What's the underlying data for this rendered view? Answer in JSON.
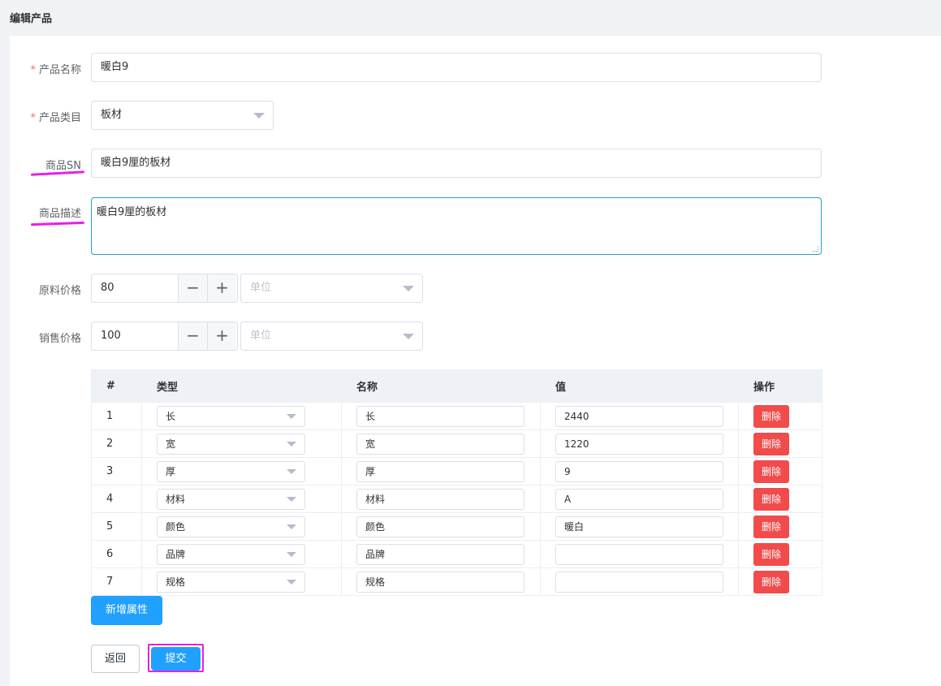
{
  "page": {
    "title": "编辑产品"
  },
  "form": {
    "name": {
      "label": "产品名称",
      "required_mark": "*",
      "value": "暖白9"
    },
    "category": {
      "label": "产品类目",
      "required_mark": "*",
      "value": "板材"
    },
    "sn": {
      "label": "商品SN",
      "value": "暖白9厘的板材"
    },
    "description": {
      "label": "商品描述",
      "value": "暖白9厘的板材"
    },
    "raw_price": {
      "label": "原料价格",
      "value": "80",
      "unit_placeholder": "单位",
      "minus": "−",
      "plus": "+"
    },
    "sale_price": {
      "label": "销售价格",
      "value": "100",
      "unit_placeholder": "单位",
      "minus": "−",
      "plus": "+"
    }
  },
  "attributes": {
    "headers": {
      "index": "#",
      "type": "类型",
      "name": "名称",
      "value": "值",
      "action": "操作"
    },
    "delete_label": "删除",
    "rows": [
      {
        "index": "1",
        "type": "长",
        "name": "长",
        "value": "2440"
      },
      {
        "index": "2",
        "type": "宽",
        "name": "宽",
        "value": "1220"
      },
      {
        "index": "3",
        "type": "厚",
        "name": "厚",
        "value": "9"
      },
      {
        "index": "4",
        "type": "材料",
        "name": "材料",
        "value": "A"
      },
      {
        "index": "5",
        "type": "颜色",
        "name": "颜色",
        "value": "暖白"
      },
      {
        "index": "6",
        "type": "品牌",
        "name": "品牌",
        "value": ""
      },
      {
        "index": "7",
        "type": "规格",
        "name": "规格",
        "value": ""
      }
    ]
  },
  "buttons": {
    "add_attr": "新增属性",
    "back": "返回",
    "submit": "提交"
  },
  "colors": {
    "primary": "#20a0ff",
    "danger": "#f14b4b",
    "annotation": "#e61fe6",
    "required": "#f56c6c"
  }
}
